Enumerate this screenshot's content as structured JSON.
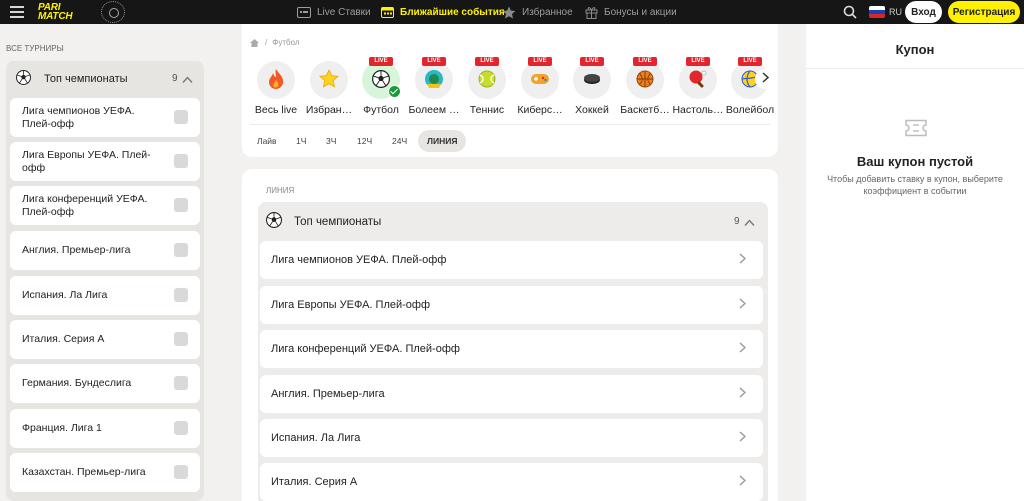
{
  "header": {
    "brand_line1": "PARI",
    "brand_line2": "MATCH",
    "nav": [
      {
        "label": "Live Ставки",
        "icon": "live-bets-icon"
      },
      {
        "label": "Ближайшие события",
        "icon": "calendar-icon",
        "active": true
      },
      {
        "label": "Избранное",
        "icon": "star-icon"
      },
      {
        "label": "Бонусы и акции",
        "icon": "gift-icon"
      }
    ],
    "lang": "RU",
    "login": "Вход",
    "register": "Регистрация",
    "accent_color": "#fff200"
  },
  "sidebar": {
    "title": "ВСЕ ТУРНИРЫ",
    "group_title": "Топ чемпионаты",
    "group_count": "9",
    "items": [
      {
        "label": "Лига чемпионов УЕФА. Плей-офф"
      },
      {
        "label": "Лига Европы УЕФА. Плей-офф"
      },
      {
        "label": "Лига конференций УЕФА. Плей-офф"
      },
      {
        "label": "Англия. Премьер-лига"
      },
      {
        "label": "Испания. Ла Лига"
      },
      {
        "label": "Италия. Серия А"
      },
      {
        "label": "Германия. Бундеслига"
      },
      {
        "label": "Франция. Лига 1"
      },
      {
        "label": "Казахстан. Премьер-лига"
      }
    ]
  },
  "breadcrumb": {
    "current": "Футбол"
  },
  "sports": [
    {
      "name": "Весь live",
      "live": false,
      "icon": "fire-icon"
    },
    {
      "name": "Избран…",
      "live": false,
      "icon": "star-icon"
    },
    {
      "name": "Футбол",
      "live": true,
      "selected": true,
      "icon": "football-icon"
    },
    {
      "name": "Болеем …",
      "live": true,
      "icon": "fan-icon"
    },
    {
      "name": "Теннис",
      "live": true,
      "icon": "tennis-icon"
    },
    {
      "name": "Киберс…",
      "live": true,
      "icon": "gamepad-icon"
    },
    {
      "name": "Хоккей",
      "live": true,
      "icon": "hockey-icon"
    },
    {
      "name": "Баскетб…",
      "live": true,
      "icon": "basketball-icon"
    },
    {
      "name": "Настоль…",
      "live": true,
      "icon": "table-tennis-icon"
    },
    {
      "name": "Волейбол",
      "live": true,
      "icon": "volleyball-icon"
    }
  ],
  "live_badge": "LIVE",
  "filters": [
    {
      "label": "Лайв"
    },
    {
      "label": "1Ч"
    },
    {
      "label": "3Ч"
    },
    {
      "label": "12Ч"
    },
    {
      "label": "24Ч"
    },
    {
      "label": "ЛИНИЯ",
      "active": true
    }
  ],
  "main": {
    "section_title": "ЛИНИЯ",
    "group_title": "Топ чемпионаты",
    "group_count": "9",
    "rows": [
      {
        "label": "Лига чемпионов УЕФА. Плей-офф"
      },
      {
        "label": "Лига Европы УЕФА. Плей-офф"
      },
      {
        "label": "Лига конференций УЕФА. Плей-офф"
      },
      {
        "label": "Англия. Премьер-лига"
      },
      {
        "label": "Испания. Ла Лига"
      },
      {
        "label": "Италия. Серия А"
      }
    ]
  },
  "coupon": {
    "title": "Купон",
    "empty_title": "Ваш купон пустой",
    "empty_text": "Чтобы добавить ставку в купон, выберите коэффициент в событии"
  }
}
